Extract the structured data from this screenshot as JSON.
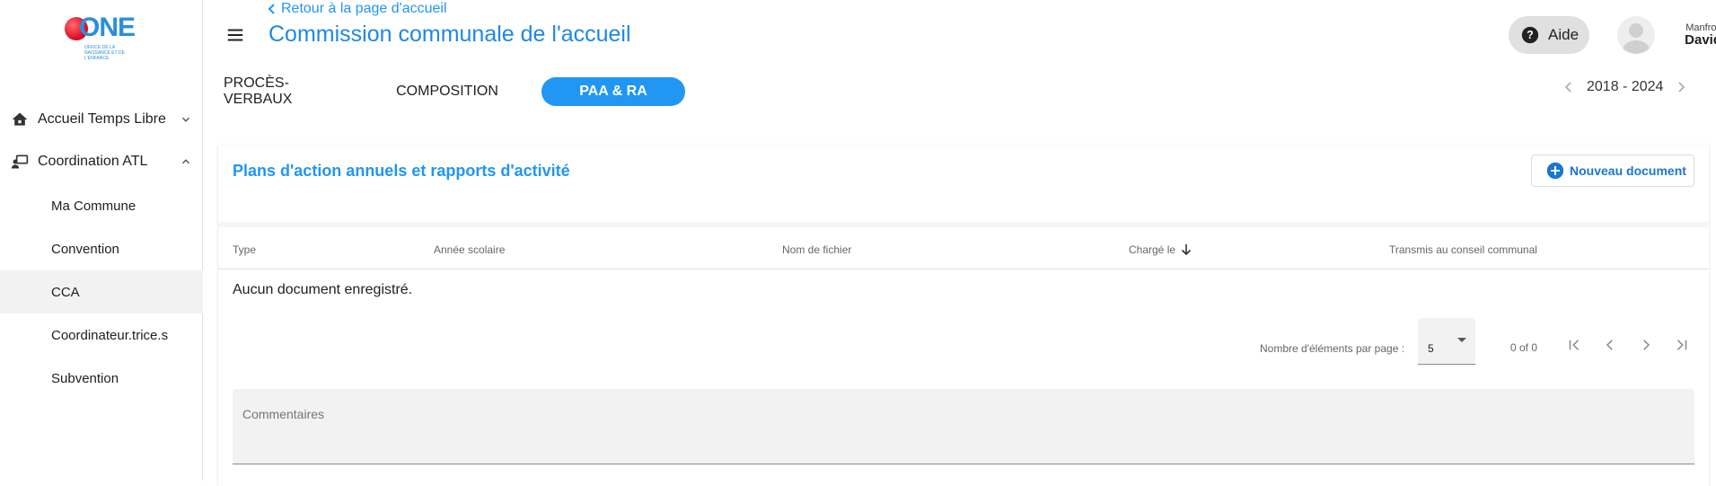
{
  "brand": {
    "logo_text": "ONE",
    "logo_tagline": "Office de la naissance et de l'enfance",
    "colors": {
      "primary": "#2196f3",
      "logo_red": "#e0102a",
      "logo_blue": "#2a8fdc"
    }
  },
  "sidebar": {
    "items": [
      {
        "label": "Accueil Temps Libre",
        "icon": "home-icon",
        "expanded": false
      },
      {
        "label": "Coordination ATL",
        "icon": "coordination-icon",
        "expanded": true,
        "children": [
          {
            "label": "Ma Commune",
            "active": false
          },
          {
            "label": "Convention",
            "active": false
          },
          {
            "label": "CCA",
            "active": true
          },
          {
            "label": "Coordinateur.trice.s",
            "active": false
          },
          {
            "label": "Subvention",
            "active": false
          }
        ]
      }
    ]
  },
  "header": {
    "back_label": "Retour à la page d'accueil",
    "title": "Commission communale de l'accueil",
    "help_label": "Aide",
    "user": {
      "first_name": "Manfroy",
      "last_name": "David"
    }
  },
  "tabs": [
    {
      "label": "PROCÈS-VERBAUX",
      "active": false
    },
    {
      "label": "COMPOSITION",
      "active": false
    },
    {
      "label": "PAA & RA",
      "active": true
    }
  ],
  "period": {
    "label": "2018 - 2024"
  },
  "card": {
    "title": "Plans d'action annuels et rapports d'activité",
    "new_button_label": "Nouveau document",
    "columns": [
      "Type",
      "Année scolaire",
      "Nom de fichier",
      "Chargé le",
      "Transmis au conseil communal"
    ],
    "sorted_column": "Chargé le",
    "sort_direction": "desc",
    "empty_message": "Aucun document enregistré.",
    "pagination": {
      "per_page_label": "Nombre d'éléments par page :",
      "per_page_value": "5",
      "range_label": "0 of 0"
    },
    "comment_placeholder": "Commentaires"
  }
}
